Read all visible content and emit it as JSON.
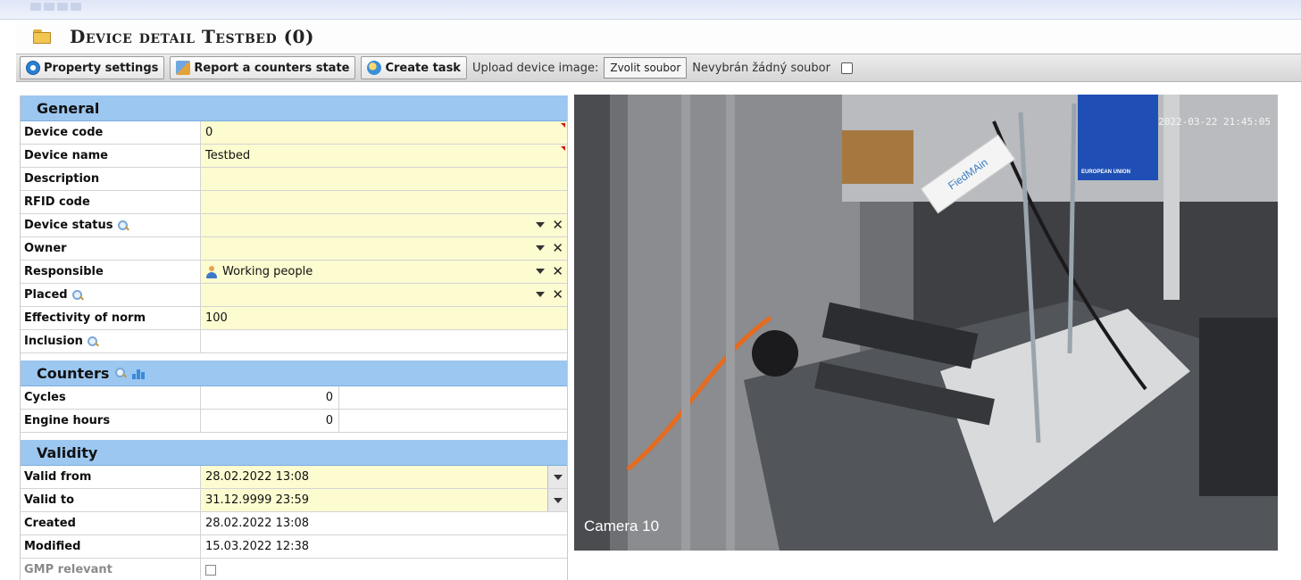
{
  "page": {
    "title": "Device detail  Testbed (0)"
  },
  "toolbar": {
    "property_settings": "Property settings",
    "report_counters": "Report a counters state",
    "create_task": "Create task",
    "upload_label": "Upload device image:",
    "choose_file": "Zvolit soubor",
    "no_file": "Nevybrán žádný soubor"
  },
  "general": {
    "title": "General",
    "device_code": {
      "label": "Device code",
      "value": "0"
    },
    "device_name": {
      "label": "Device name",
      "value": "Testbed"
    },
    "description": {
      "label": "Description",
      "value": ""
    },
    "rfid": {
      "label": "RFID code",
      "value": ""
    },
    "device_status": {
      "label": "Device status",
      "value": ""
    },
    "owner": {
      "label": "Owner",
      "value": ""
    },
    "responsible": {
      "label": "Responsible",
      "value": "Working people"
    },
    "placed": {
      "label": "Placed",
      "value": ""
    },
    "effectivity": {
      "label": "Effectivity of norm",
      "value": "100"
    },
    "inclusion": {
      "label": "Inclusion",
      "value": ""
    }
  },
  "counters": {
    "title": "Counters",
    "cycles": {
      "label": "Cycles",
      "value": "0"
    },
    "engine_hours": {
      "label": "Engine hours",
      "value": "0"
    }
  },
  "validity": {
    "title": "Validity",
    "valid_from": {
      "label": "Valid from",
      "value": "28.02.2022 13:08"
    },
    "valid_to": {
      "label": "Valid to",
      "value": "31.12.9999 23:59"
    },
    "created": {
      "label": "Created",
      "value": "28.02.2022 13:08"
    },
    "modified": {
      "label": "Modified",
      "value": "15.03.2022 12:38"
    },
    "gmp": {
      "label": "GMP relevant"
    }
  },
  "camera": {
    "label": "Camera 10",
    "timestamp": "2022-03-22 21:45:05",
    "banner_text": "EUROPEAN UNION",
    "tag_text": "FiedMAin"
  },
  "colors": {
    "section_header": "#9cc7f0",
    "required_field": "#fdfbd0",
    "toolbar": "#d6d6d6"
  }
}
